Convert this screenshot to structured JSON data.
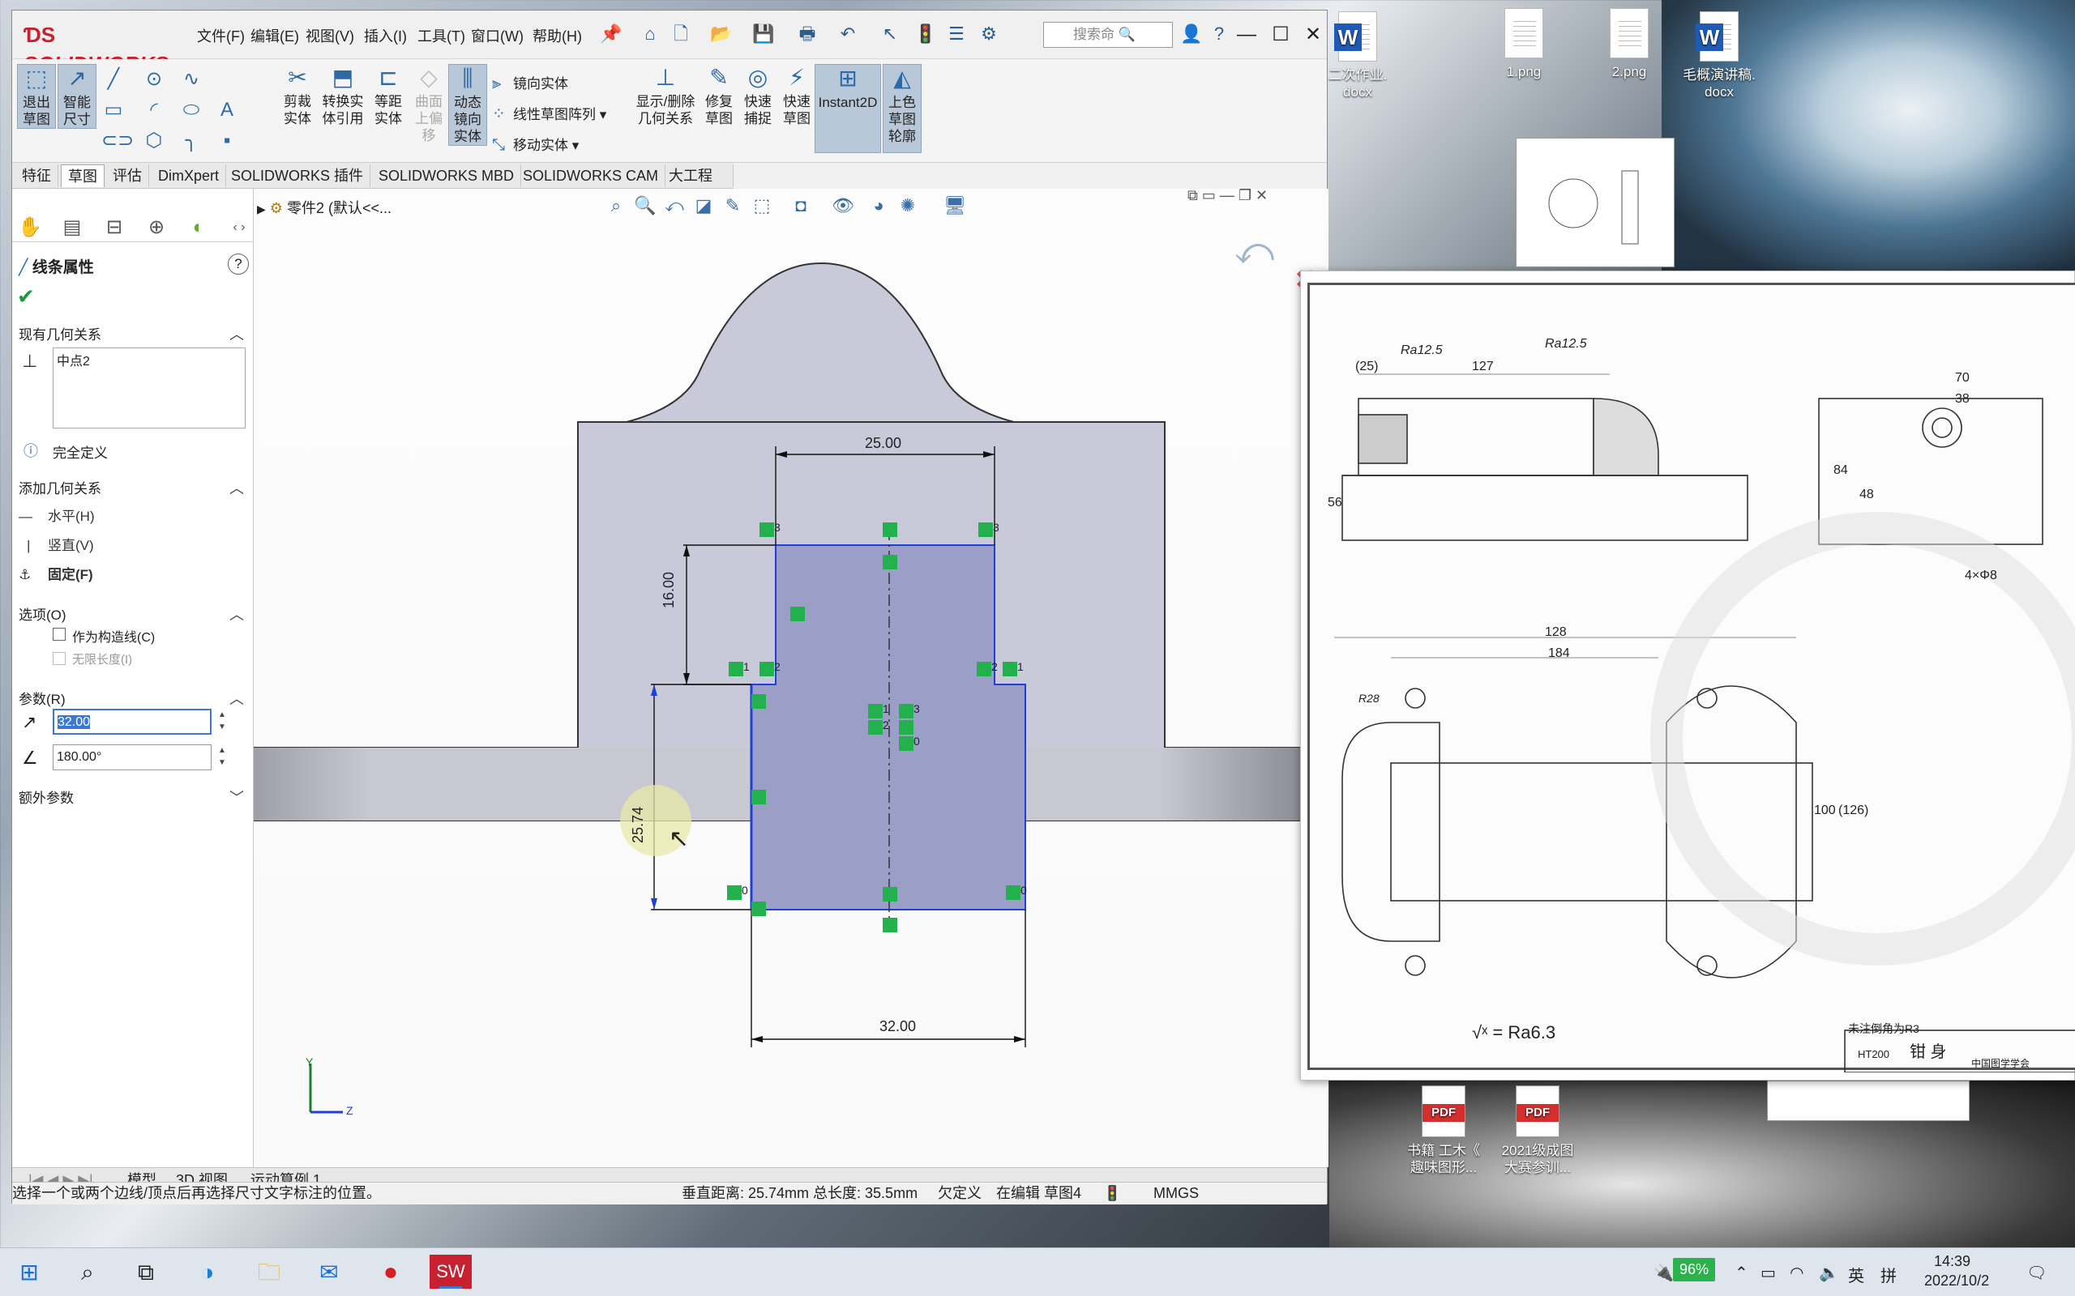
{
  "desktop": {
    "icons": [
      {
        "label": "二次作业.\ndocx",
        "type": "word"
      },
      {
        "label": "1.png",
        "type": "image"
      },
      {
        "label": "2.png",
        "type": "image"
      },
      {
        "label": "毛概演讲稿.\ndocx",
        "type": "word"
      },
      {
        "label": "书籍  工木《\n趣味图形...",
        "type": "pdf"
      },
      {
        "label": "2021级成图\n大赛参训...",
        "type": "pdf"
      }
    ],
    "pdf_badge": "PDF",
    "word_badge": "W"
  },
  "solidworks": {
    "logo": "SOLIDWORKS",
    "menus": [
      "文件(F)",
      "编辑(E)",
      "视图(V)",
      "插入(I)",
      "工具(T)",
      "窗口(W)",
      "帮助(H)"
    ],
    "search_placeholder": "搜索命",
    "command_buttons": {
      "exit_sketch": "退出\n草图",
      "smart_dim": "智能\n尺寸",
      "trim": "剪裁\n实体",
      "convert": "转换实\n体引用",
      "offset": "等距\n实体",
      "surface_offset": "曲面\n上偏\n移",
      "dynamic_mirror": "动态\n镜向\n实体",
      "mirror": "镜向实体",
      "linear_pattern": "线性草图阵列",
      "move": "移动实体",
      "show_relations": "显示/删除\n几何关系",
      "repair": "修复\n草图",
      "quick_snap": "快速\n捕捉",
      "rapid_sketch": "快速\n草图",
      "instant2d": "Instant2D",
      "shaded_contour": "上色\n草图\n轮廓"
    },
    "tabs": [
      "特征",
      "草图",
      "评估",
      "DimXpert",
      "SOLIDWORKS 插件",
      "SOLIDWORKS MBD",
      "SOLIDWORKS CAM",
      "大工程师"
    ],
    "active_tab": "草图",
    "tree_root": "零件2  (默认<<...",
    "property": {
      "title": "线条属性",
      "existing_relations_header": "现有几何关系",
      "existing_relations": [
        "中点2"
      ],
      "status": "完全定义",
      "add_relations_header": "添加几何关系",
      "add_relations": [
        "水平(H)",
        "竖直(V)",
        "固定(F)"
      ],
      "options_header": "选项(O)",
      "option_construction": "作为构造线(C)",
      "option_infinite": "无限长度(I)",
      "params_header": "参数(R)",
      "length_value": "32.00",
      "angle_value": "180.00°",
      "extra_params_header": "额外参数"
    },
    "dimensions": {
      "top_width": "25.00",
      "left_height": "16.00",
      "vertical_selected": "25.74",
      "bottom_width": "32.00"
    },
    "relation_tags": [
      "3",
      "3",
      "3",
      "1",
      "2",
      "2",
      "1",
      "1",
      "3",
      "2",
      "0",
      "0",
      "0"
    ],
    "bottom_tabs": [
      "模型",
      "3D 视图",
      "运动算例 1"
    ],
    "status_bar": {
      "message": "选择一个或两个边线/顶点后再选择尺寸文字标注的位置。",
      "measure": "垂直距离: 25.74mm 总长度: 35.5mm",
      "definition": "欠定义",
      "editing": "在编辑 草图4",
      "units": "MMGS"
    },
    "axis": {
      "y": "Y",
      "z": "Z"
    }
  },
  "viewer": {
    "labels": {
      "ra_top": "Ra12.5",
      "ra_mid": "Ra12.5",
      "dim_127": "127",
      "dim_25": "(25)",
      "dim_184": "184",
      "dim_70": "70",
      "dim_38": "38",
      "dim_128": "128",
      "dim_100": "100",
      "dim_126": "(126)",
      "dim_56": "56",
      "dim_84": "84",
      "dim_48": "48",
      "holes": "4×Φ8",
      "fillet_note": "未注倒角为R3",
      "surface_eq": "= Ra6.3",
      "r28": "R28",
      "part_name": "钳  身",
      "material": "HT200",
      "org": "中国图学学会"
    }
  },
  "taskbar": {
    "battery": "96%",
    "ime": "英",
    "ime2": "拼",
    "time": "14:39",
    "date": "2022/10/2"
  },
  "colors": {
    "sketch_fill": "#9b9fc8",
    "part_fill": "#c9cad9",
    "accent_red": "#c8202e",
    "relation_green": "#22b14c",
    "selection_blue": "#1f3fd6"
  }
}
